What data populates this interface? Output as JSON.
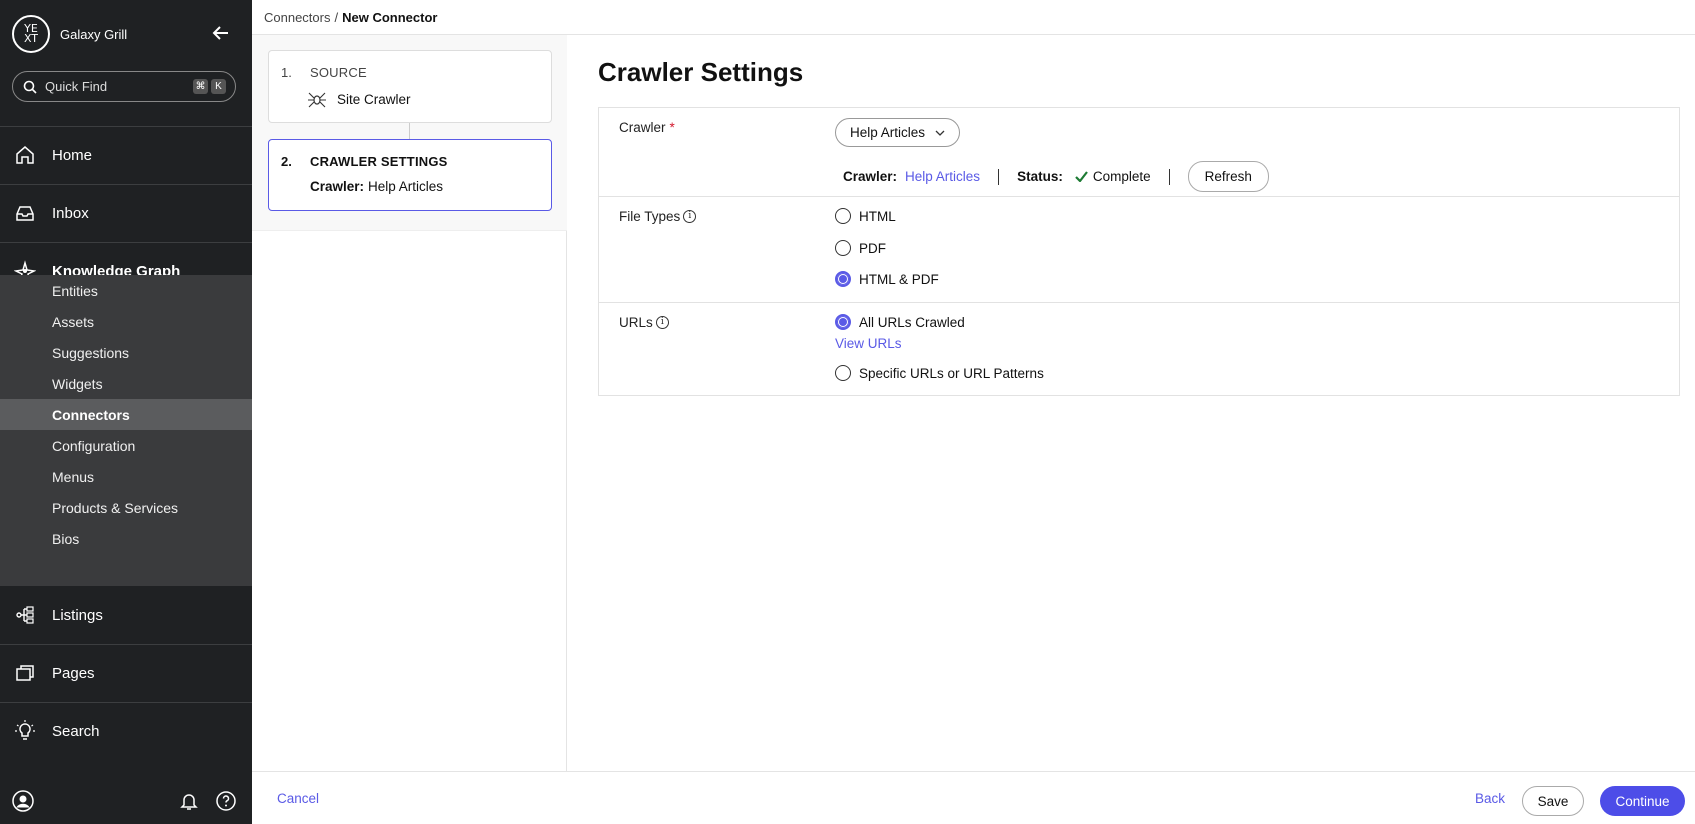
{
  "app": {
    "org_name": "Galaxy Grill",
    "logo_text": "YEXT"
  },
  "quick_find": {
    "placeholder": "Quick Find",
    "shortcut_cmd": "⌘",
    "shortcut_key": "K"
  },
  "nav": {
    "home": "Home",
    "inbox": "Inbox",
    "knowledge_graph": "Knowledge Graph",
    "kg_items": [
      "Entities",
      "Assets",
      "Suggestions",
      "Widgets",
      "Connectors",
      "Configuration",
      "Menus",
      "Products & Services",
      "Bios"
    ],
    "listings": "Listings",
    "pages": "Pages",
    "search": "Search"
  },
  "breadcrumb": {
    "parent": "Connectors",
    "separator": "/",
    "current": "New Connector"
  },
  "steps": {
    "step1": {
      "num": "1.",
      "title": "SOURCE",
      "value": "Site Crawler"
    },
    "step2": {
      "num": "2.",
      "title": "CRAWLER SETTINGS",
      "label": "Crawler:",
      "value": "Help Articles"
    }
  },
  "main": {
    "title": "Crawler Settings",
    "crawler": {
      "label": "Crawler",
      "required": "*",
      "selected": "Help Articles",
      "status_crawler_label": "Crawler:",
      "status_crawler_value": "Help Articles",
      "status_label": "Status:",
      "status_value": "Complete",
      "refresh": "Refresh"
    },
    "file_types": {
      "label": "File Types",
      "options": [
        "HTML",
        "PDF",
        "HTML & PDF"
      ],
      "selected": "HTML & PDF"
    },
    "urls": {
      "label": "URLs",
      "option_all": "All URLs Crawled",
      "view_urls": "View URLs",
      "option_specific": "Specific URLs or URL Patterns",
      "selected": "All URLs Crawled"
    }
  },
  "footer": {
    "cancel": "Cancel",
    "back": "Back",
    "save": "Save",
    "continue": "Continue"
  },
  "colors": {
    "accent": "#4d4de8",
    "sidebar": "#1f2123",
    "success": "#1e7b34",
    "required": "#d3192e"
  }
}
